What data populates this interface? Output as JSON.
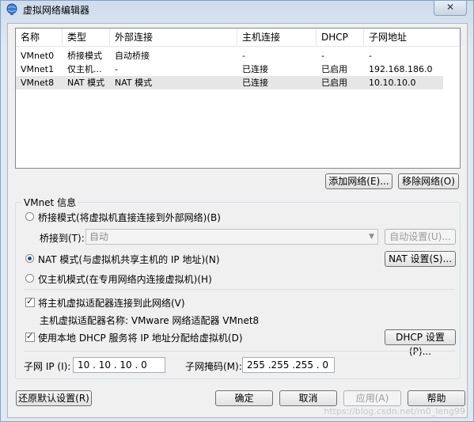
{
  "window": {
    "title": "虚拟网络编辑器",
    "close": "✕"
  },
  "table": {
    "headers": [
      "名称",
      "类型",
      "外部连接",
      "主机连接",
      "DHCP",
      "子网地址"
    ],
    "rows": [
      [
        "VMnet0",
        "桥接模式",
        "自动桥接",
        "-",
        "-",
        "-"
      ],
      [
        "VMnet1",
        "仅主机...",
        "-",
        "已连接",
        "已启用",
        "192.168.186.0"
      ],
      [
        "VMnet8",
        "NAT 模式",
        "NAT 模式",
        "已连接",
        "已启用",
        "10.10.10.0"
      ]
    ]
  },
  "buttons": {
    "add_network": "添加网络(E)...",
    "remove_network": "移除网络(O)",
    "auto_settings": "自动设置(U)...",
    "nat_settings": "NAT 设置(S)...",
    "dhcp_settings": "DHCP 设置(P)...",
    "restore_defaults": "还原默认设置(R)",
    "ok": "确定",
    "cancel": "取消",
    "apply": "应用(A)",
    "help": "帮助"
  },
  "vmnet_info": {
    "group_title": "VMnet 信息",
    "bridged_label": "桥接模式(将虚拟机直接连接到外部网络)(B)",
    "bridge_to_label": "桥接到(T):",
    "bridge_to_value": "自动",
    "nat_label": "NAT 模式(与虚拟机共享主机的 IP 地址)(N)",
    "host_only_label": "仅主机模式(在专用网络内连接虚拟机)(H)",
    "connect_adapter_label": "将主机虚拟适配器连接到此网络(V)",
    "adapter_name_text": "主机虚拟适配器名称: VMware 网络适配器 VMnet8",
    "use_dhcp_label": "使用本地 DHCP 服务将 IP 地址分配给虚拟机(D)",
    "subnet_ip_label": "子网 IP (I):",
    "subnet_ip_value": "10 . 10 . 10 . 0",
    "subnet_mask_label": "子网掩码(M):",
    "subnet_mask_value": "255 .255 .255 . 0"
  },
  "watermark": "https://blog.csdn.net/m0_leng99"
}
